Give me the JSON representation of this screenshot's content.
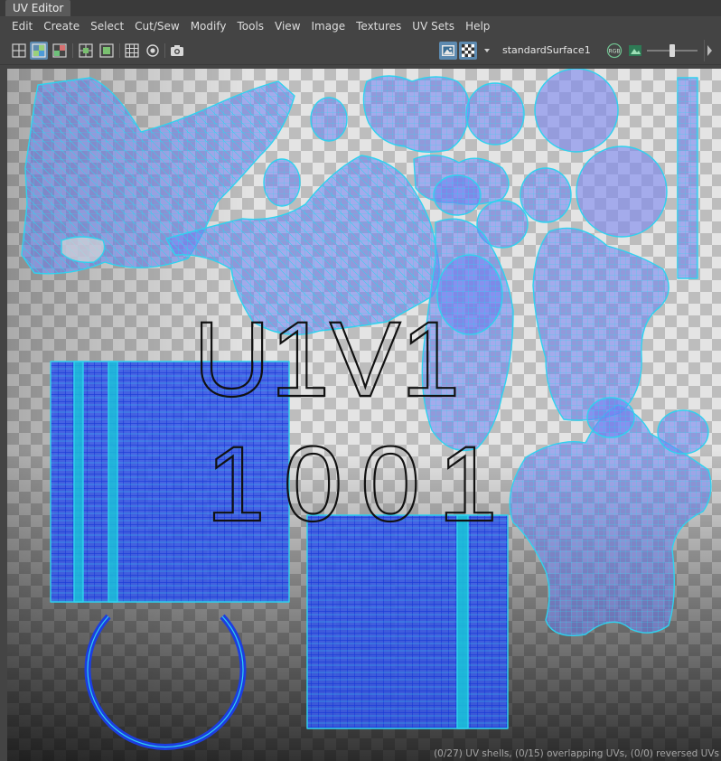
{
  "window": {
    "title": "UV Editor"
  },
  "menu": [
    "Edit",
    "Create",
    "Select",
    "Cut/Sew",
    "Modify",
    "Tools",
    "View",
    "Image",
    "Textures",
    "UV Sets",
    "Help"
  ],
  "toolbar": {
    "material": "standardSurface1",
    "icons": [
      "uv-layout-icon",
      "uv-shaded-icon",
      "uv-distortion-icon",
      "grid-snap-icon",
      "pixel-snap-icon",
      "grid-icon",
      "texture-borders-icon",
      "snapshot-icon",
      "image-display-icon",
      "checker-icon",
      "rgb-channels-icon",
      "image-ratio-icon"
    ],
    "exposure_level": 0.55
  },
  "viewport": {
    "tile_label_line1": "U1V1",
    "tile_label_line2": "1001",
    "colors": {
      "shell_fill": "#6e7cf2",
      "shell_edge": "#2fd2ee",
      "strip_cyan": "#1ac6d8",
      "dense_blue": "#1840e0"
    }
  },
  "status": {
    "text": "(0/27) UV shells, (0/15) overlapping UVs, (0/0) reversed UVs"
  }
}
